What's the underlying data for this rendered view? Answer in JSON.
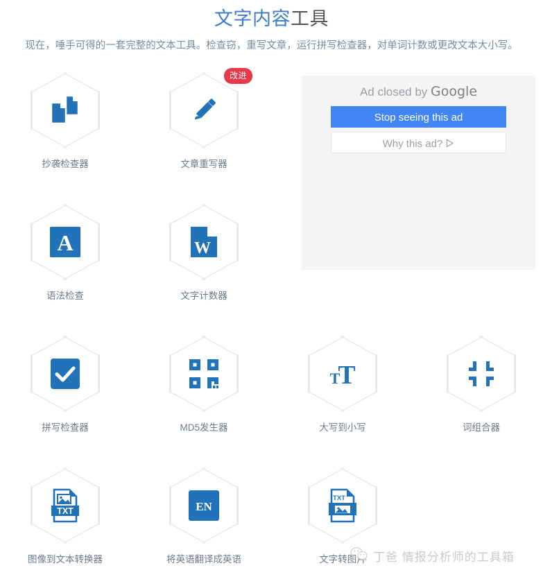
{
  "header": {
    "title_accent": "文字内容",
    "title_rest": "工具",
    "subtitle": "现在，唾手可得的一套完整的文本工具。检查窃，重写文章，运行拼写检查器，对单词计数或更改文本大小写。",
    "accent_color": "#3d7cc9",
    "title_color": "#555555"
  },
  "tools": [
    {
      "label": "抄袭检查器",
      "icon": "copy-documents-icon",
      "badge": null,
      "row": 1,
      "col": 1
    },
    {
      "label": "文章重写器",
      "icon": "pencil-icon",
      "badge": "改进",
      "row": 1,
      "col": 2
    },
    {
      "label": "语法检查",
      "icon": "letter-a-square-icon",
      "badge": null,
      "row": 2,
      "col": 1
    },
    {
      "label": "文字计数器",
      "icon": "word-document-icon",
      "badge": null,
      "row": 2,
      "col": 2
    },
    {
      "label": "拼写检查器",
      "icon": "checkbox-check-icon",
      "badge": null,
      "row": 3,
      "col": 1
    },
    {
      "label": "MD5发生器",
      "icon": "qr-code-icon",
      "badge": null,
      "row": 3,
      "col": 2
    },
    {
      "label": "大写到小写",
      "icon": "text-case-icon",
      "badge": null,
      "row": 3,
      "col": 3
    },
    {
      "label": "词组合器",
      "icon": "compress-arrows-icon",
      "badge": null,
      "row": 3,
      "col": 4
    },
    {
      "label": "图像到文本转换器",
      "icon": "image-to-txt-icon",
      "badge": null,
      "row": 4,
      "col": 1
    },
    {
      "label": "将英语翻译成英语",
      "icon": "en-square-icon",
      "badge": null,
      "row": 4,
      "col": 2
    },
    {
      "label": "文字转图片",
      "icon": "txt-to-image-icon",
      "badge": null,
      "row": 4,
      "col": 3
    }
  ],
  "ad": {
    "headline_prefix": "Ad closed by ",
    "headline_brand": "Google",
    "primary_label": "Stop seeing this ad",
    "secondary_label": "Why this ad?",
    "primary_color": "#4285f4",
    "panel_color": "#f4f4f4"
  },
  "watermark": {
    "text": "丁爸 情报分析师的工具箱",
    "icon": "wechat-icon",
    "color": "#c9c9c9"
  },
  "icon_color": "#2272b9",
  "badge_color": "#e8394a"
}
